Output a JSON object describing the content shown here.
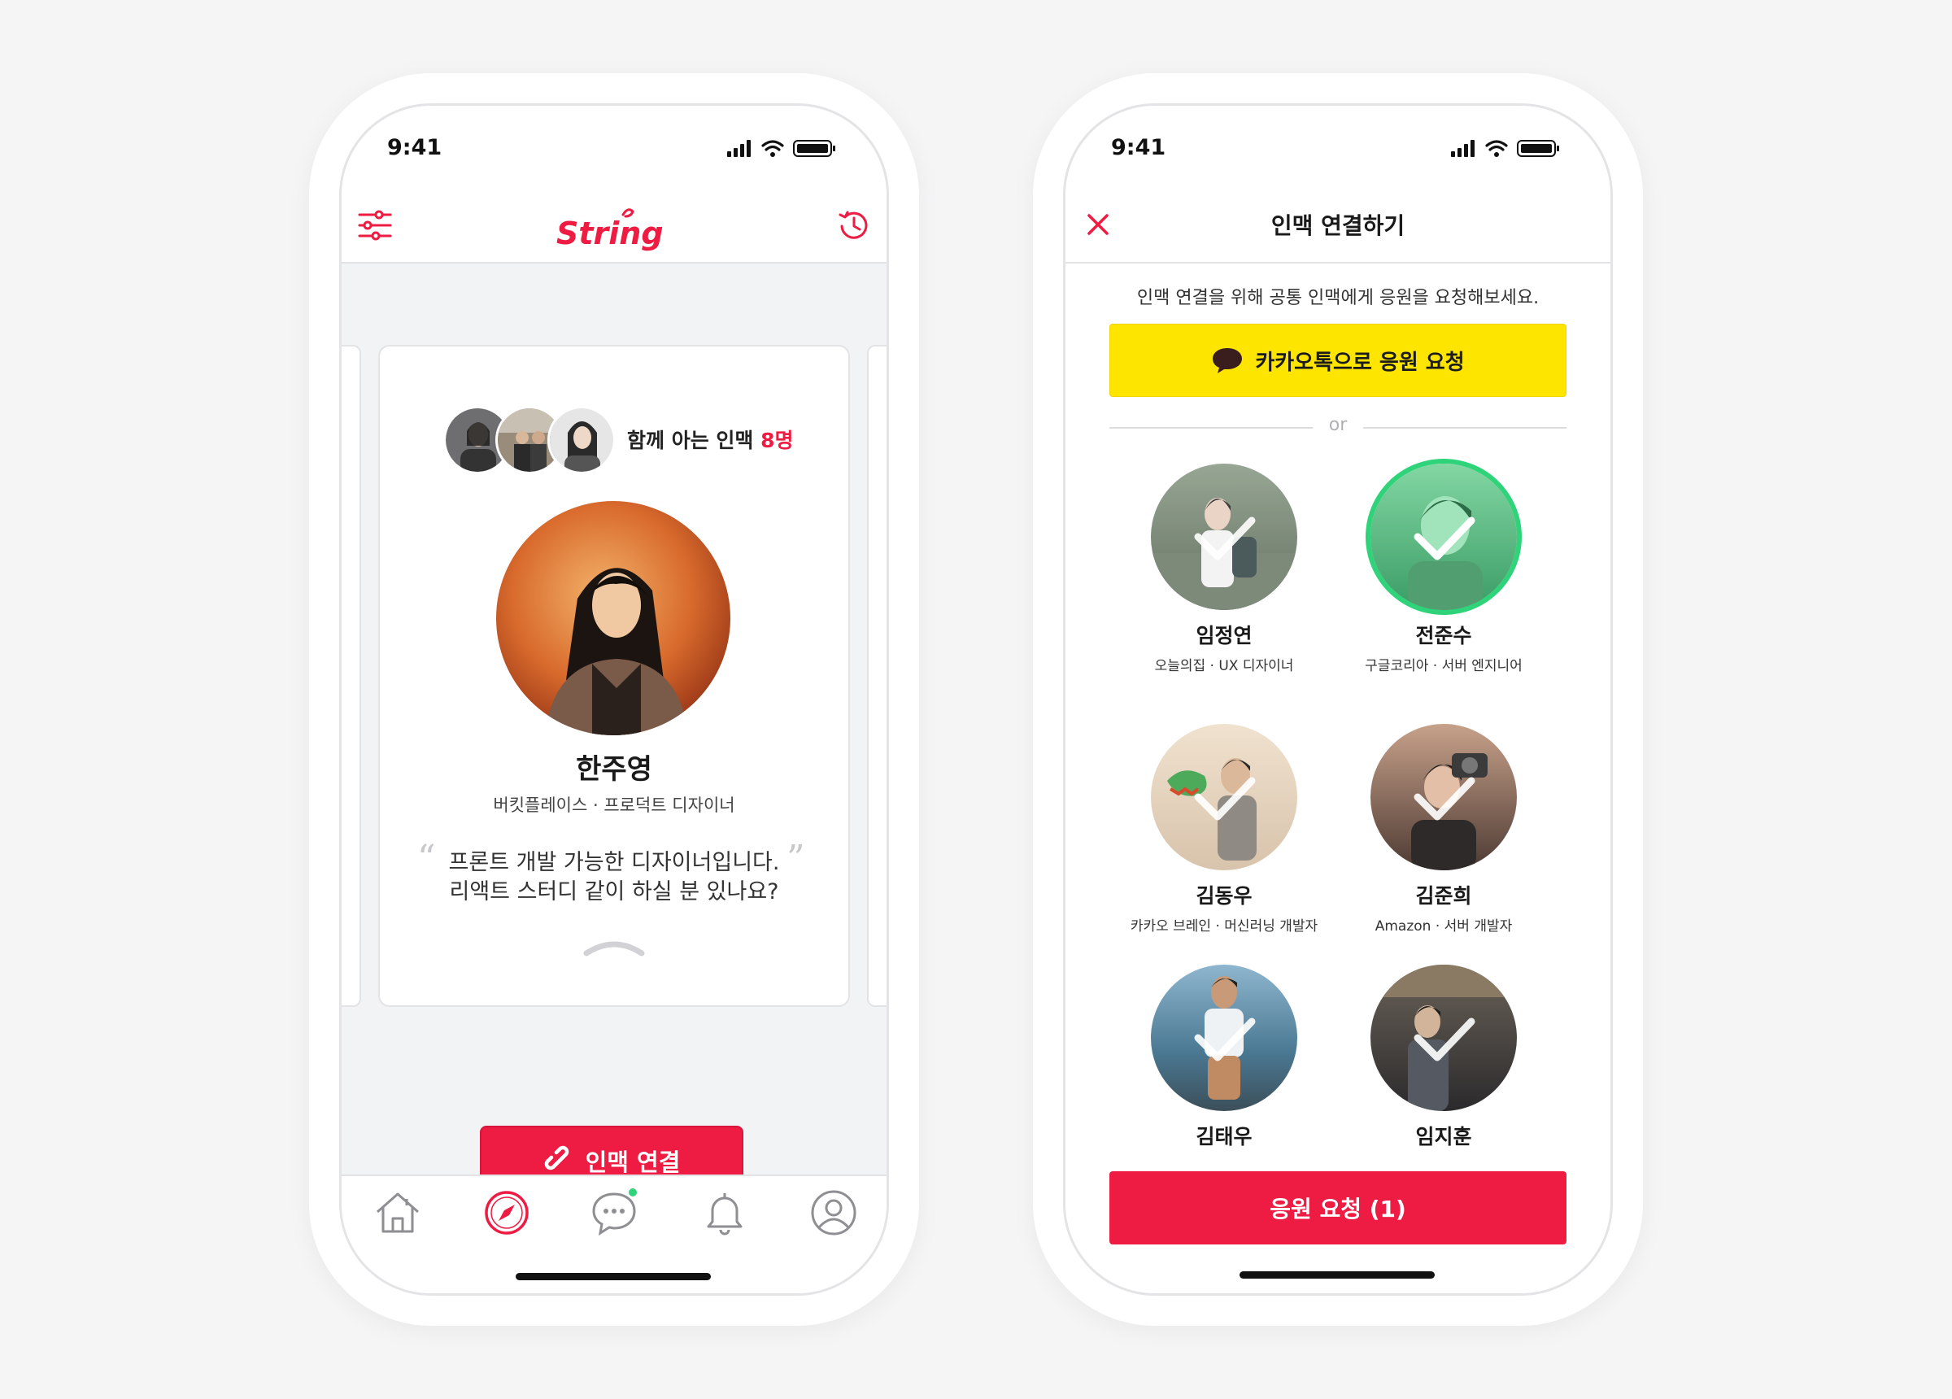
{
  "status_bar": {
    "time": "9:41"
  },
  "left_screen": {
    "app_logo": "String",
    "mutual": {
      "label": "함께 아는 인맥 ",
      "count": "8명"
    },
    "profile": {
      "name": "한주영",
      "subtitle": "버킷플레이스 · 프로덕트 디자이너",
      "quote_open": "“",
      "quote_close": "”",
      "quote_line1": "프론트 개발 가능한 디자이너입니다.",
      "quote_line2": "리액트 스터디 같이 하실 분 있나요?"
    },
    "connect_button": "인맥 연결",
    "tab_bar": [
      "home-icon",
      "compass-icon",
      "chat-icon",
      "bell-icon",
      "profile-icon"
    ],
    "colors": {
      "brand": "#ee1c43",
      "chat_badge": "#2fd37a"
    }
  },
  "right_screen": {
    "title": "인맥 연결하기",
    "guide": "인맥 연결을 위해 공통 인맥에게 응원을 요청해보세요.",
    "kakao_button": "카카오톡으로 응원 요청",
    "or_label": "or",
    "friends": [
      {
        "name": "임정연",
        "subtitle": "오늘의집 · UX 디자이너",
        "selected": false
      },
      {
        "name": "전준수",
        "subtitle": "구글코리아 · 서버 엔지니어",
        "selected": true
      },
      {
        "name": "김동우",
        "subtitle": "카카오 브레인 · 머신러닝 개발자",
        "selected": false
      },
      {
        "name": "김준희",
        "subtitle": "Amazon · 서버 개발자",
        "selected": false
      },
      {
        "name": "김태우",
        "subtitle": "",
        "selected": false
      },
      {
        "name": "임지훈",
        "subtitle": "",
        "selected": false
      }
    ],
    "support_button": "응원 요청 (1)",
    "colors": {
      "kakao": "#fee500",
      "selected_ring": "#2fd37a",
      "brand": "#ee1c43"
    }
  }
}
